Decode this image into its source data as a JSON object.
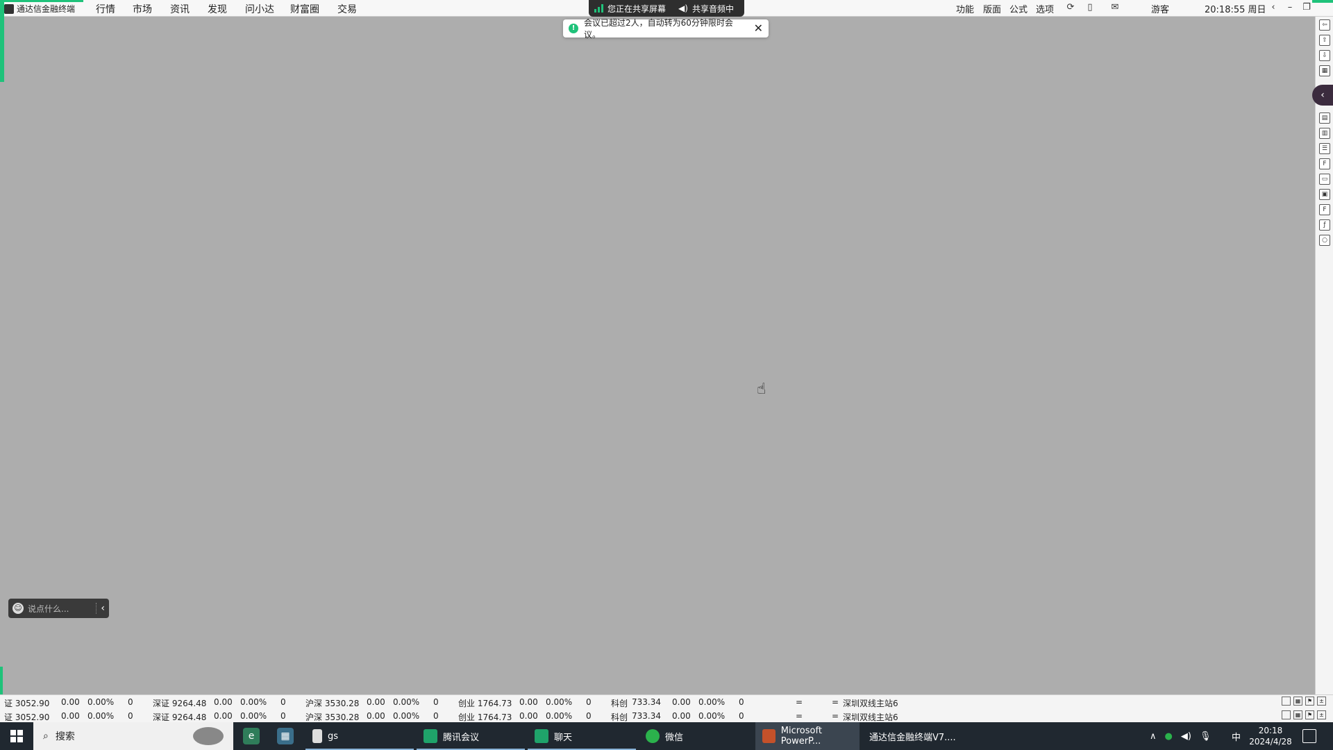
{
  "app": {
    "title": "通达信金融终端"
  },
  "menu": [
    "行情",
    "市场",
    "资讯",
    "发现",
    "问小达",
    "财富圈",
    "交易"
  ],
  "right_menu": [
    "功能",
    "版面",
    "公式",
    "选项"
  ],
  "user": "游客",
  "datetime": "20:18:55 周日",
  "share": {
    "screen_label": "您正在共享屏幕",
    "audio_label": "共享音频中"
  },
  "toast": {
    "message": "会议已超过2人，自动转为60分钟限时会议。"
  },
  "chat": {
    "placeholder": "说点什么..."
  },
  "status_rows": [
    {
      "items": [
        "证 3052.90",
        "0.00",
        "0.00%",
        "0",
        "深证 9264.48",
        "0.00",
        "0.00%",
        "0",
        "沪深 3530.28",
        "0.00",
        "0.00%",
        "0",
        "创业 1764.73",
        "0.00",
        "0.00%",
        "0",
        "科创",
        "733.34",
        "0.00",
        "0.00%",
        "0",
        "=",
        "=",
        "深圳双线主站6"
      ]
    },
    {
      "items": [
        "证 3052.90",
        "0.00",
        "0.00%",
        "0",
        "深证 9264.48",
        "0.00",
        "0.00%",
        "0",
        "沪深 3530.28",
        "0.00",
        "0.00%",
        "0",
        "创业 1764.73",
        "0.00",
        "0.00%",
        "0",
        "科创",
        "733.34",
        "0.00",
        "0.00%",
        "0",
        "=",
        "=",
        "深圳双线主站6"
      ]
    }
  ],
  "taskbar": {
    "search_label": "搜索",
    "apps": [
      {
        "label": "gs",
        "active": false
      },
      {
        "label": "腾讯会议",
        "active": false
      },
      {
        "label": "聊天",
        "active": false
      },
      {
        "label": "微信",
        "active": false
      },
      {
        "label": "Microsoft PowerP...",
        "active": true
      },
      {
        "label": "通达信金融终端V7....",
        "active": false
      }
    ],
    "ime": "中",
    "time": "20:18",
    "date": "2024/4/28"
  },
  "colors": {
    "accent": "#1fc27a",
    "workspace": "#adadad",
    "taskbar": "#202830"
  }
}
